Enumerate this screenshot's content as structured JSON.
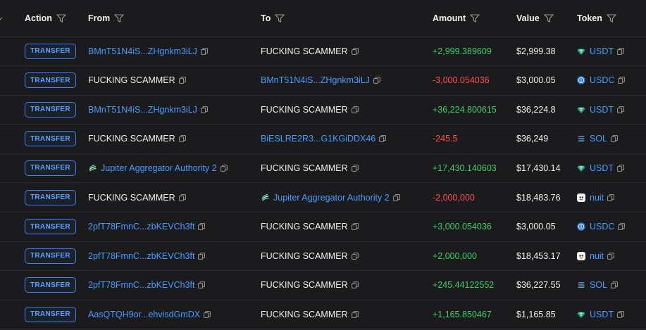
{
  "header": {
    "action": "Action",
    "from": "From",
    "to": "To",
    "amount": "Amount",
    "value": "Value",
    "token": "Token"
  },
  "colors": {
    "positive": "#3fcf6c",
    "negative": "#ff4f4f",
    "link": "#4a9cff",
    "badge": "#3b82f6"
  },
  "rows": [
    {
      "action": "TRANSFER",
      "from": "BMnT51N4iS...ZHgnkm3iLJ",
      "from_kind": "link",
      "to": "FUCKING SCAMMER",
      "to_kind": "plain",
      "amount": "+2,999.389609",
      "sign": "pos",
      "value": "$2,999.38",
      "token": "USDT",
      "token_icon": "usdt-icon"
    },
    {
      "action": "TRANSFER",
      "from": "FUCKING SCAMMER",
      "from_kind": "plain",
      "to": "BMnT51N4iS...ZHgnkm3iLJ",
      "to_kind": "link",
      "amount": "-3,000.054036",
      "sign": "neg",
      "value": "$3,000.05",
      "token": "USDC",
      "token_icon": "usdc-icon"
    },
    {
      "action": "TRANSFER",
      "from": "BMnT51N4iS...ZHgnkm3iLJ",
      "from_kind": "link",
      "to": "FUCKING SCAMMER",
      "to_kind": "plain",
      "amount": "+36,224.800615",
      "sign": "pos",
      "value": "$36,224.8",
      "token": "USDT",
      "token_icon": "usdt-icon"
    },
    {
      "action": "TRANSFER",
      "from": "FUCKING SCAMMER",
      "from_kind": "plain",
      "to": "BiESLRE2R3...G1KGiDDX46",
      "to_kind": "link",
      "amount": "-245.5",
      "sign": "neg",
      "value": "$36,249",
      "token": "SOL",
      "token_icon": "sol-icon"
    },
    {
      "action": "TRANSFER",
      "from": "Jupiter Aggregator Authority 2",
      "from_kind": "jupiter",
      "to": "FUCKING SCAMMER",
      "to_kind": "plain",
      "amount": "+17,430.140603",
      "sign": "pos",
      "value": "$17,430.14",
      "token": "USDT",
      "token_icon": "usdt-icon"
    },
    {
      "action": "TRANSFER",
      "from": "FUCKING SCAMMER",
      "from_kind": "plain",
      "to": "Jupiter Aggregator Authority 2",
      "to_kind": "jupiter",
      "amount": "-2,000,000",
      "sign": "neg",
      "value": "$18,483.76",
      "token": "nuit",
      "token_icon": "nuit-icon"
    },
    {
      "action": "TRANSFER",
      "from": "2pfT78FmnC...zbKEVCh3ft",
      "from_kind": "link",
      "to": "FUCKING SCAMMER",
      "to_kind": "plain",
      "amount": "+3,000.054036",
      "sign": "pos",
      "value": "$3,000.05",
      "token": "USDC",
      "token_icon": "usdc-icon"
    },
    {
      "action": "TRANSFER",
      "from": "2pfT78FmnC...zbKEVCh3ft",
      "from_kind": "link",
      "to": "FUCKING SCAMMER",
      "to_kind": "plain",
      "amount": "+2,000,000",
      "sign": "pos",
      "value": "$18,453.17",
      "token": "nuit",
      "token_icon": "nuit-icon"
    },
    {
      "action": "TRANSFER",
      "from": "2pfT78FmnC...zbKEVCh3ft",
      "from_kind": "link",
      "to": "FUCKING SCAMMER",
      "to_kind": "plain",
      "amount": "+245.44122552",
      "sign": "pos",
      "value": "$36,227.55",
      "token": "SOL",
      "token_icon": "sol-icon"
    },
    {
      "action": "TRANSFER",
      "from": "AasQTQH9or...ehvisdGmDX",
      "from_kind": "link",
      "to": "FUCKING SCAMMER",
      "to_kind": "plain",
      "amount": "+1,165.850467",
      "sign": "pos",
      "value": "$1,165.85",
      "token": "USDT",
      "token_icon": "usdt-icon"
    }
  ]
}
